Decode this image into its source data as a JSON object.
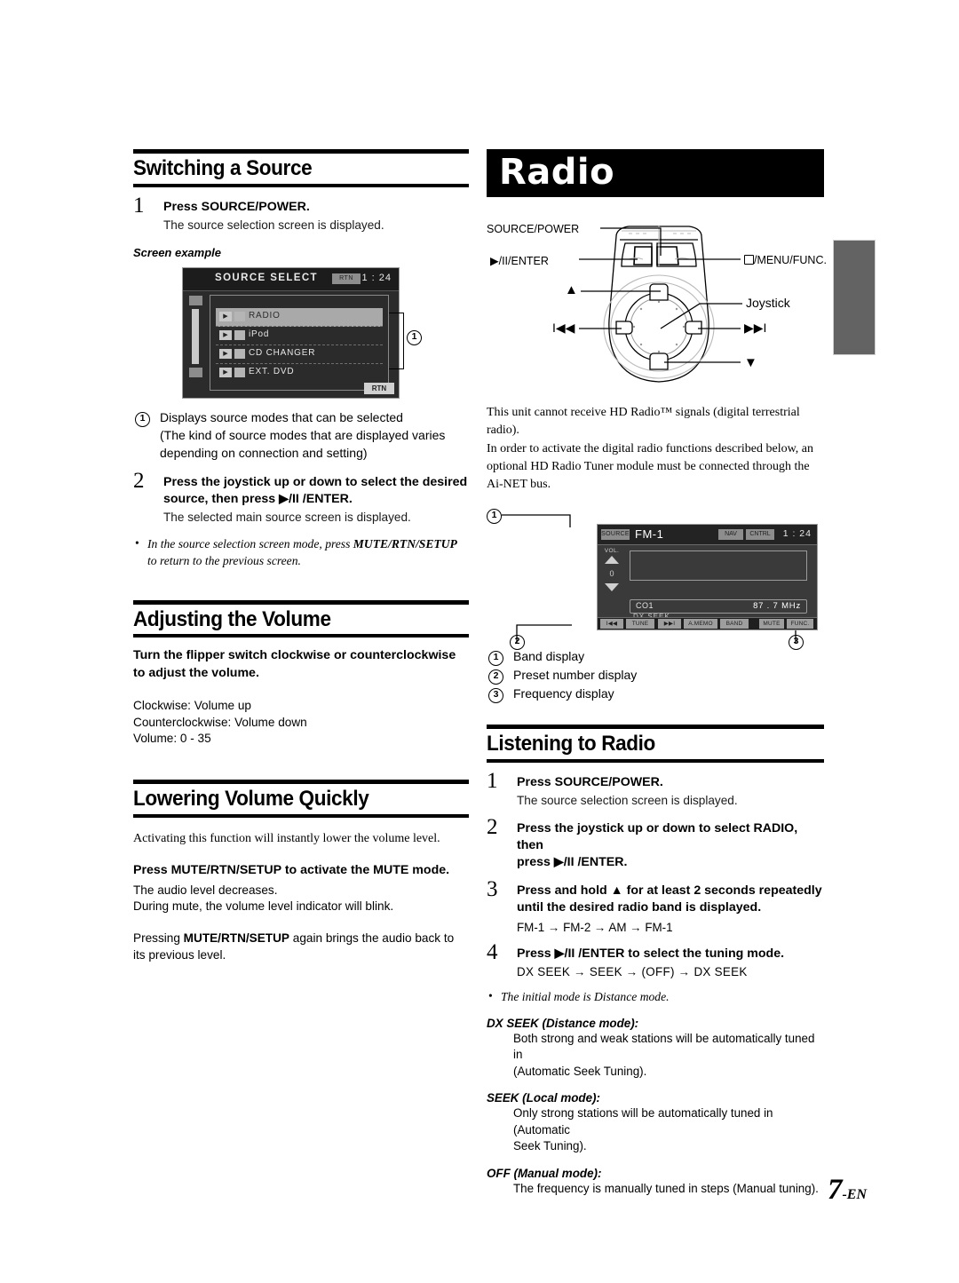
{
  "page": {
    "number": "7",
    "suffix": "-EN"
  },
  "left": {
    "section1": {
      "heading": "Switching a Source",
      "step1": {
        "num": "1",
        "text_a": "Press ",
        "text_b": "SOURCE/POWER",
        "text_c": ".",
        "sub": "The source selection screen is displayed."
      },
      "screen_example_label": "Screen example",
      "screenshot": {
        "title": "SOURCE  SELECT",
        "rtn_chip": "RTN",
        "clock": "1 : 24",
        "items": [
          {
            "play": "▶",
            "icon": "radio-icon",
            "name": "RADIO",
            "selected": true
          },
          {
            "play": "▶",
            "icon": "ipod-icon",
            "name": "iPod",
            "selected": false
          },
          {
            "play": "▶",
            "icon": "disc-icon",
            "name": "CD  CHANGER",
            "selected": false
          },
          {
            "play": "▶",
            "icon": "disc-icon",
            "name": "EXT. DVD",
            "selected": false
          }
        ],
        "footer_button": "RTN",
        "callout": "1"
      },
      "callout1": {
        "num": "1",
        "line1": "Displays source modes that can be selected",
        "line2": "(The kind of source modes that are displayed varies",
        "line3": "depending on connection and setting)"
      },
      "step2": {
        "num": "2",
        "t1": "Press the ",
        "t2": "joystick",
        "t3": " up or down to select the desired",
        "t4": "source, then press ",
        "t5": "▶/II /ENTER",
        "t6": ".",
        "sub": "The selected main source screen is displayed."
      },
      "note": {
        "a": "In the source selection screen mode, press ",
        "b": "MUTE/RTN/SETUP",
        "c": " to return to the previous screen."
      }
    },
    "section2": {
      "heading": "Adjusting the Volume",
      "instruction_a": "Turn the ",
      "instruction_b": "flipper switch",
      "instruction_c": " clockwise or counterclockwise to adjust the volume.",
      "lines": [
        "Clockwise: Volume up",
        "Counterclockwise: Volume down",
        "Volume: 0 - 35"
      ]
    },
    "section3": {
      "heading": "Lowering Volume Quickly",
      "intro": "Activating this function will instantly lower the volume level.",
      "bold_a": "Press ",
      "bold_b": "MUTE/RTN/SETUP",
      "bold_c": " to activate the MUTE mode.",
      "lines": [
        "The audio level decreases.",
        "During mute, the volume level indicator will blink."
      ],
      "para_a": "Pressing ",
      "para_b": "MUTE/RTN/SETUP",
      "para_c": " again brings the audio back to its previous level."
    }
  },
  "right": {
    "banner": "Radio",
    "diagram": {
      "labels": {
        "source_power": "SOURCE/POWER",
        "enter": "▶/II/ENTER",
        "menu_func": "/MENU/FUNC.",
        "up": "▲",
        "joystick": "Joystick",
        "prev": "I◀◀",
        "next": "▶▶I",
        "down": "▼"
      }
    },
    "hd_note": [
      "This unit cannot receive HD Radio™ signals (digital terrestrial radio).",
      "In order to activate the digital radio functions described below, an",
      "optional HD Radio Tuner module must be connected through the",
      "Ai-NET bus."
    ],
    "radio_screen": {
      "source_chip": "SOURCE",
      "band": "FM-1",
      "nav_chip": "NAV",
      "cntrl_chip": "CNTRL",
      "clock": "1 : 24",
      "vol_label": "VOL.",
      "vol_value": "0",
      "preset": "CO1",
      "frequency": "87 . 7  MHz",
      "tuning_mode": "DX  SEEK",
      "bottom_keys": [
        "I◀◀",
        "TUNE",
        "▶▶I",
        "A.MEMO",
        "BAND",
        "MUTE",
        "FUNC."
      ],
      "callouts": {
        "c1": "1",
        "c2": "2",
        "c3": "3"
      }
    },
    "callouts": [
      {
        "num": "1",
        "text": "Band display"
      },
      {
        "num": "2",
        "text": "Preset number display"
      },
      {
        "num": "3",
        "text": "Frequency display"
      }
    ],
    "section_listening": {
      "heading": "Listening to Radio",
      "step1": {
        "num": "1",
        "a": "Press ",
        "b": "SOURCE/POWER",
        "c": ".",
        "sub": "The source selection screen is displayed."
      },
      "step2": {
        "num": "2",
        "a": "Press the ",
        "b": "joystick",
        "c": " up or down to select RADIO, then",
        "d": "press ",
        "e": "▶/II /ENTER",
        "f": "."
      },
      "step3": {
        "num": "3",
        "a": "Press and hold ▲ for at least 2 seconds repeatedly",
        "b": "until the desired radio band is displayed.",
        "chain": "FM-1 → FM-2 → AM → FM-1"
      },
      "step4": {
        "num": "4",
        "a": "Press ",
        "b": "▶/II /ENTER",
        "c": " to select the tuning mode.",
        "chain": "DX SEEK   →     SEEK    →    (OFF)     →   DX SEEK"
      },
      "note": "The initial mode is Distance mode.",
      "modes": [
        {
          "label": "DX SEEK (Distance mode):",
          "lines": [
            "Both strong and weak stations will be automatically tuned in",
            "(Automatic Seek Tuning)."
          ]
        },
        {
          "label": "SEEK (Local mode):",
          "lines": [
            "Only strong stations will be automatically tuned in (Automatic",
            "Seek Tuning)."
          ]
        },
        {
          "label": "OFF (Manual mode):",
          "lines": [
            "The frequency is manually tuned in steps (Manual tuning)."
          ]
        }
      ]
    }
  }
}
